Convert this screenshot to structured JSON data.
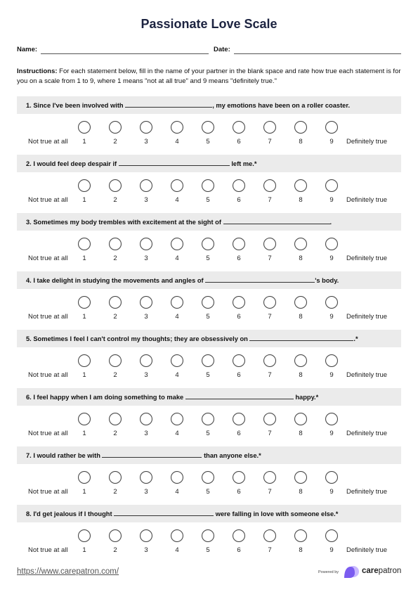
{
  "title": "Passionate Love Scale",
  "form": {
    "name_label": "Name:",
    "name_value": "",
    "date_label": "Date:",
    "date_value": ""
  },
  "instructions": {
    "label": "Instructions:",
    "text": " For each statement below, fill in the name of your partner in the blank space and rate how true each statement is for you on a scale from 1 to 9, where 1 means \"not at all true\" and 9 means \"definitely true.\""
  },
  "scale": {
    "low_label": "Not true at all",
    "high_label": "Definitely true",
    "options": [
      "1",
      "2",
      "3",
      "4",
      "5",
      "6",
      "7",
      "8",
      "9"
    ]
  },
  "questions": [
    {
      "before": "1. Since I've been involved with ",
      "after": ", my emotions have been on a roller coaster.",
      "selected": null
    },
    {
      "before": "2. I would feel deep despair if ",
      "after": " left me.*",
      "selected": null
    },
    {
      "before": "3. Sometimes my body trembles with excitement at the sight of ",
      "after": ".",
      "selected": null
    },
    {
      "before": "4. I take delight in studying the movements and angles of ",
      "after": "'s body.",
      "selected": null
    },
    {
      "before": "5. Sometimes I feel I can't control my thoughts; they are obsessively on ",
      "after": ".*",
      "selected": null
    },
    {
      "before": "6. I feel happy when I am doing something to make ",
      "after": " happy.*",
      "selected": null
    },
    {
      "before": "7. I would rather be with ",
      "after": " than anyone else.*",
      "selected": null
    },
    {
      "before": "8. I'd get jealous if I thought ",
      "after": " were falling in love with someone else.*",
      "selected": null
    }
  ],
  "footer": {
    "url": "https://www.carepatron.com/",
    "powered_by": "Powered by",
    "brand_bold": "care",
    "brand_regular": "patron",
    "brand_color": "#7b5cf0",
    "brand_color_light": "#c9b8ff"
  }
}
